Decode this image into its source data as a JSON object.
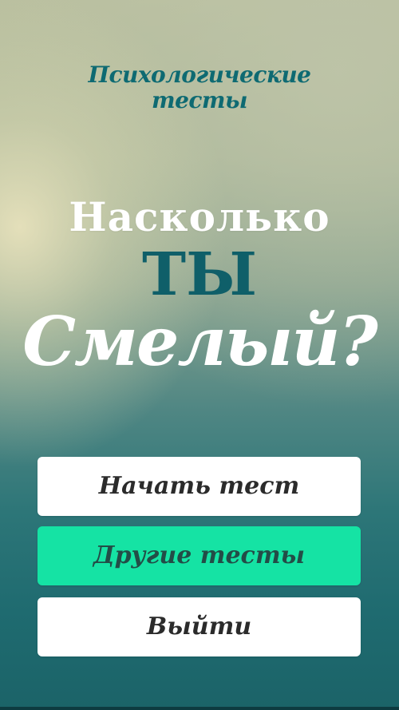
{
  "app_title": {
    "line1": "Психологические",
    "line2": "тесты"
  },
  "headline": {
    "line1": "Насколько",
    "line2": "ТЫ",
    "line3": "Смелый?"
  },
  "buttons": {
    "start": "Начать тест",
    "other": "Другие тесты",
    "exit": "Выйти"
  },
  "colors": {
    "accent_teal": "#0f5f69",
    "other_button_green": "#15e3a4",
    "button_white": "#ffffff"
  }
}
